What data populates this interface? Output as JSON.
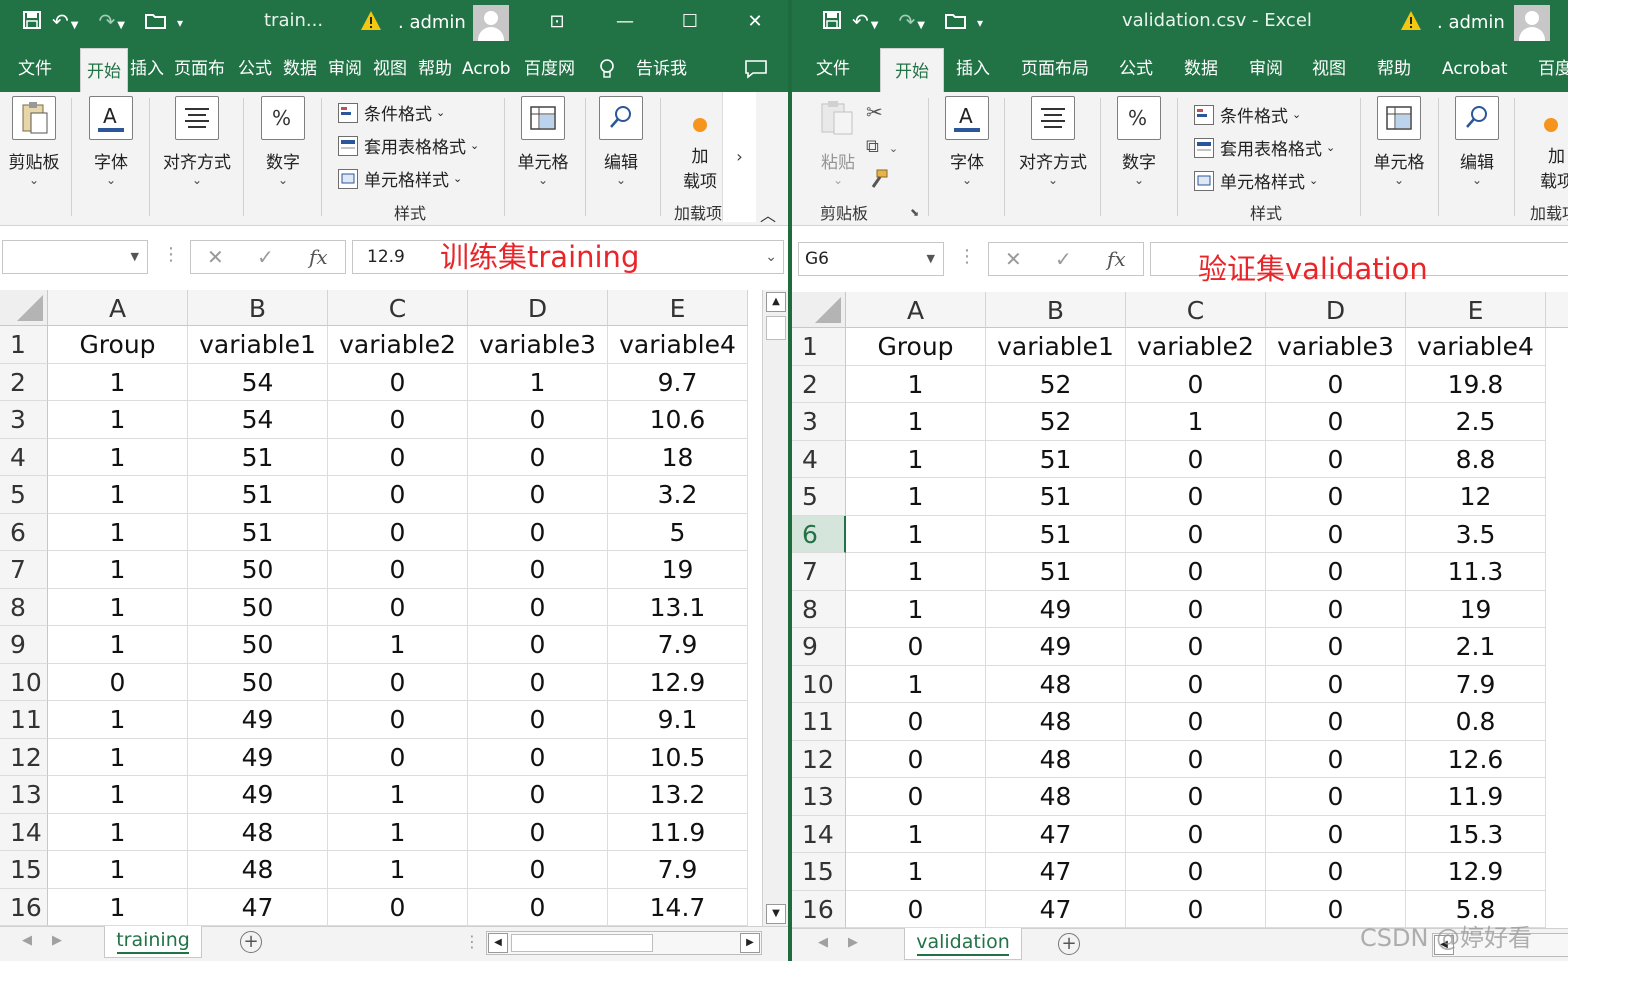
{
  "colors": {
    "excel_green": "#217346",
    "annotation_red": "#e8262a"
  },
  "left": {
    "window_title": "train...",
    "user": ". admin",
    "tabs": [
      "文件",
      "开始",
      "插入",
      "页面布",
      "公式",
      "数据",
      "审阅",
      "视图",
      "帮助",
      "Acrob",
      "百度网",
      "告诉我"
    ],
    "active_tab_index": 1,
    "ribbon": {
      "clipboard": "剪贴板",
      "font": "字体",
      "align": "对齐方式",
      "number": "数字",
      "cond_format": "条件格式",
      "table_format": "套用表格格式",
      "cell_style": "单元格样式",
      "styles_group": "样式",
      "cells": "单元格",
      "editing": "编辑",
      "addin_a": "加",
      "addin_b": "载项",
      "addin_group": "加载项"
    },
    "formula_bar": {
      "name_box": "",
      "value": "12.9"
    },
    "annotation": "训练集training",
    "columns": [
      "A",
      "B",
      "C",
      "D",
      "E"
    ],
    "rows": [
      [
        "Group",
        "variable1",
        "variable2",
        "variable3",
        "variable4"
      ],
      [
        "1",
        "54",
        "0",
        "1",
        "9.7"
      ],
      [
        "1",
        "54",
        "0",
        "0",
        "10.6"
      ],
      [
        "1",
        "51",
        "0",
        "0",
        "18"
      ],
      [
        "1",
        "51",
        "0",
        "0",
        "3.2"
      ],
      [
        "1",
        "51",
        "0",
        "0",
        "5"
      ],
      [
        "1",
        "50",
        "0",
        "0",
        "19"
      ],
      [
        "1",
        "50",
        "0",
        "0",
        "13.1"
      ],
      [
        "1",
        "50",
        "1",
        "0",
        "7.9"
      ],
      [
        "0",
        "50",
        "0",
        "0",
        "12.9"
      ],
      [
        "1",
        "49",
        "0",
        "0",
        "9.1"
      ],
      [
        "1",
        "49",
        "0",
        "0",
        "10.5"
      ],
      [
        "1",
        "49",
        "1",
        "0",
        "13.2"
      ],
      [
        "1",
        "48",
        "1",
        "0",
        "11.9"
      ],
      [
        "1",
        "48",
        "1",
        "0",
        "7.9"
      ],
      [
        "1",
        "47",
        "0",
        "0",
        "14.7"
      ]
    ],
    "sheet_tab": "training"
  },
  "right": {
    "window_title": "validation.csv  -  Excel",
    "user": ". admin",
    "tabs": [
      "文件",
      "开始",
      "插入",
      "页面布局",
      "公式",
      "数据",
      "审阅",
      "视图",
      "帮助",
      "Acrobat",
      "百度"
    ],
    "active_tab_index": 1,
    "ribbon": {
      "paste": "粘贴",
      "clipboard": "剪贴板",
      "font": "字体",
      "align": "对齐方式",
      "number": "数字",
      "cond_format": "条件格式",
      "table_format": "套用表格格式",
      "cell_style": "单元格样式",
      "styles_group": "样式",
      "cells": "单元格",
      "editing": "编辑",
      "addin_a": "加",
      "addin_b": "载项",
      "addin_group": "加载项"
    },
    "formula_bar": {
      "name_box": "G6",
      "value": ""
    },
    "annotation": "验证集validation",
    "columns": [
      "A",
      "B",
      "C",
      "D",
      "E"
    ],
    "rows": [
      [
        "Group",
        "variable1",
        "variable2",
        "variable3",
        "variable4"
      ],
      [
        "1",
        "52",
        "0",
        "0",
        "19.8"
      ],
      [
        "1",
        "52",
        "1",
        "0",
        "2.5"
      ],
      [
        "1",
        "51",
        "0",
        "0",
        "8.8"
      ],
      [
        "1",
        "51",
        "0",
        "0",
        "12"
      ],
      [
        "1",
        "51",
        "0",
        "0",
        "3.5"
      ],
      [
        "1",
        "51",
        "0",
        "0",
        "11.3"
      ],
      [
        "1",
        "49",
        "0",
        "0",
        "19"
      ],
      [
        "0",
        "49",
        "0",
        "0",
        "2.1"
      ],
      [
        "1",
        "48",
        "0",
        "0",
        "7.9"
      ],
      [
        "0",
        "48",
        "0",
        "0",
        "0.8"
      ],
      [
        "0",
        "48",
        "0",
        "0",
        "12.6"
      ],
      [
        "0",
        "48",
        "0",
        "0",
        "11.9"
      ],
      [
        "1",
        "47",
        "0",
        "0",
        "15.3"
      ],
      [
        "1",
        "47",
        "0",
        "0",
        "12.9"
      ],
      [
        "0",
        "47",
        "0",
        "0",
        "5.8"
      ]
    ],
    "selected_row": 6,
    "sheet_tab": "validation"
  },
  "watermark": "CSDN @婷好看"
}
